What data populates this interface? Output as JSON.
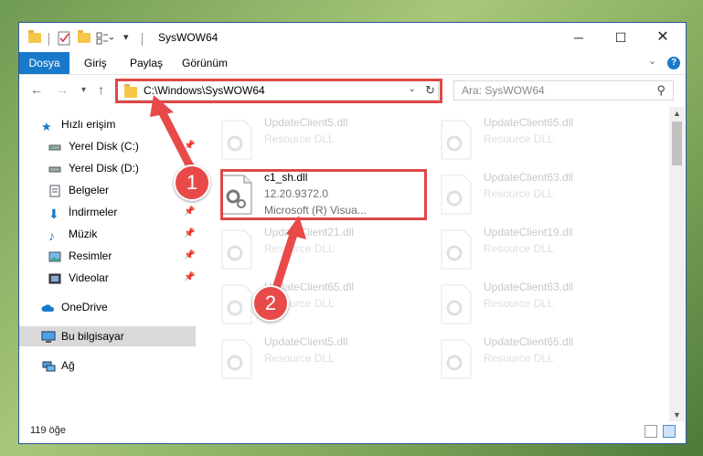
{
  "window": {
    "title": "SysWOW64"
  },
  "ribbon": {
    "file_tab": "Dosya",
    "tabs": [
      "Giriş",
      "Paylaş",
      "Görünüm"
    ]
  },
  "nav": {
    "address": "C:\\Windows\\SysWOW64",
    "search_placeholder": "Ara: SysWOW64"
  },
  "sidebar": {
    "items": [
      {
        "label": "Hızlı erişim",
        "icon": "star-icon"
      },
      {
        "label": "Yerel Disk (C:)",
        "icon": "drive-icon",
        "pinned": true
      },
      {
        "label": "Yerel Disk (D:)",
        "icon": "drive-icon",
        "pinned": true
      },
      {
        "label": "Belgeler",
        "icon": "documents-icon",
        "pinned": true
      },
      {
        "label": "İndirmeler",
        "icon": "download-icon",
        "pinned": true
      },
      {
        "label": "Müzik",
        "icon": "music-icon",
        "pinned": true
      },
      {
        "label": "Resimler",
        "icon": "pictures-icon",
        "pinned": true
      },
      {
        "label": "Videolar",
        "icon": "videos-icon",
        "pinned": true
      },
      {
        "label": "OneDrive",
        "icon": "cloud-icon"
      },
      {
        "label": "Bu bilgisayar",
        "icon": "computer-icon",
        "selected": true
      },
      {
        "label": "Ağ",
        "icon": "network-icon"
      }
    ]
  },
  "files": {
    "highlighted": {
      "name": "c1_sh.dll",
      "version": "12.20.9372.0",
      "company": "Microsoft (R) Visua..."
    },
    "faded": [
      {
        "name": "UpdateClient5.dll",
        "type": "Resource DLL"
      },
      {
        "name": "UpdateClient65.dll",
        "type": "Resource DLL"
      },
      {
        "name": "UpdateClient63.dll",
        "type": "Resource DLL"
      },
      {
        "name": "UpdateClient21.dll",
        "type": "Resource DLL"
      },
      {
        "name": "UpdateClient19.dll",
        "type": "Resource DLL"
      },
      {
        "name": "UpdateClient65.dll",
        "type": "Resource DLL"
      },
      {
        "name": "UpdateClient63.dll",
        "type": "Resource DLL"
      },
      {
        "name": "UpdateClient5.dll",
        "type": "Resource DLL"
      },
      {
        "name": "UpdateClient65.dll",
        "type": "Resource DLL"
      }
    ]
  },
  "status": {
    "count": "119 öğe"
  },
  "annotations": {
    "badge1": "1",
    "badge2": "2"
  },
  "colors": {
    "accent": "#1979ca",
    "highlight": "#e04747"
  }
}
